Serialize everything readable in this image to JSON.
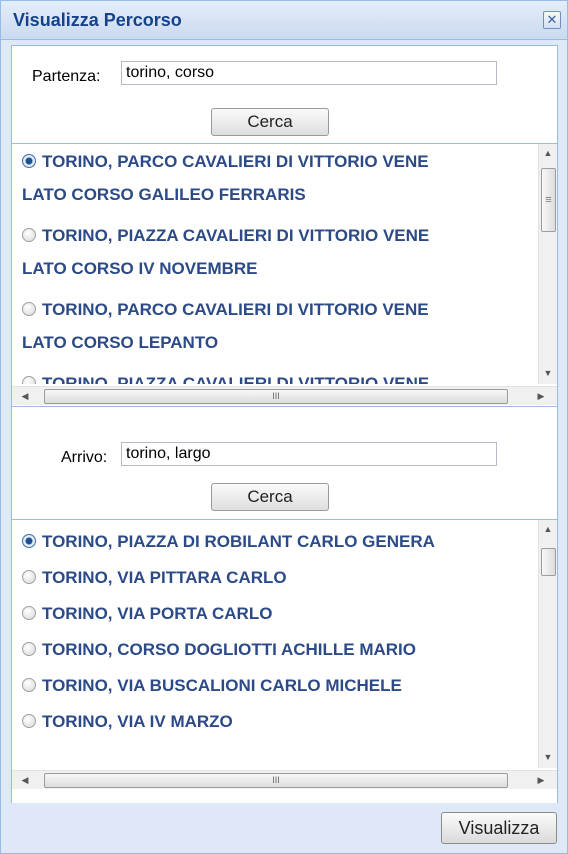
{
  "window": {
    "title": "Visualizza Percorso",
    "close_label": "✕"
  },
  "partenza": {
    "label": "Partenza:",
    "value": "torino, corso",
    "search_label": "Cerca",
    "results": [
      {
        "line1": "TORINO, PARCO CAVALIERI DI VITTORIO VENE",
        "line2": "LATO CORSO GALILEO FERRARIS",
        "selected": true
      },
      {
        "line1": "TORINO, PIAZZA CAVALIERI DI VITTORIO VENE",
        "line2": "LATO CORSO IV NOVEMBRE",
        "selected": false
      },
      {
        "line1": "TORINO, PARCO CAVALIERI DI VITTORIO VENE",
        "line2": "LATO CORSO LEPANTO",
        "selected": false
      },
      {
        "line1": "TORINO, PIAZZA CAVALIERI DI VITTORIO VENE",
        "line2": "",
        "selected": false
      }
    ]
  },
  "arrivo": {
    "label": "Arrivo:",
    "value": "torino, largo",
    "search_label": "Cerca",
    "results": [
      {
        "line1": "TORINO, PIAZZA DI ROBILANT CARLO GENERA",
        "selected": true
      },
      {
        "line1": "TORINO, VIA PITTARA CARLO",
        "selected": false
      },
      {
        "line1": "TORINO, VIA PORTA CARLO",
        "selected": false
      },
      {
        "line1": "TORINO, CORSO DOGLIOTTI ACHILLE MARIO",
        "selected": false
      },
      {
        "line1": "TORINO, VIA BUSCALIONI CARLO MICHELE",
        "selected": false
      },
      {
        "line1": "TORINO, VIA IV MARZO",
        "selected": false
      }
    ]
  },
  "scroll": {
    "up": "▲",
    "down": "▼",
    "left": "◀",
    "right": "▶",
    "grip": "III",
    "grip_v": "≡"
  },
  "footer": {
    "submit_label": "Visualizza"
  }
}
